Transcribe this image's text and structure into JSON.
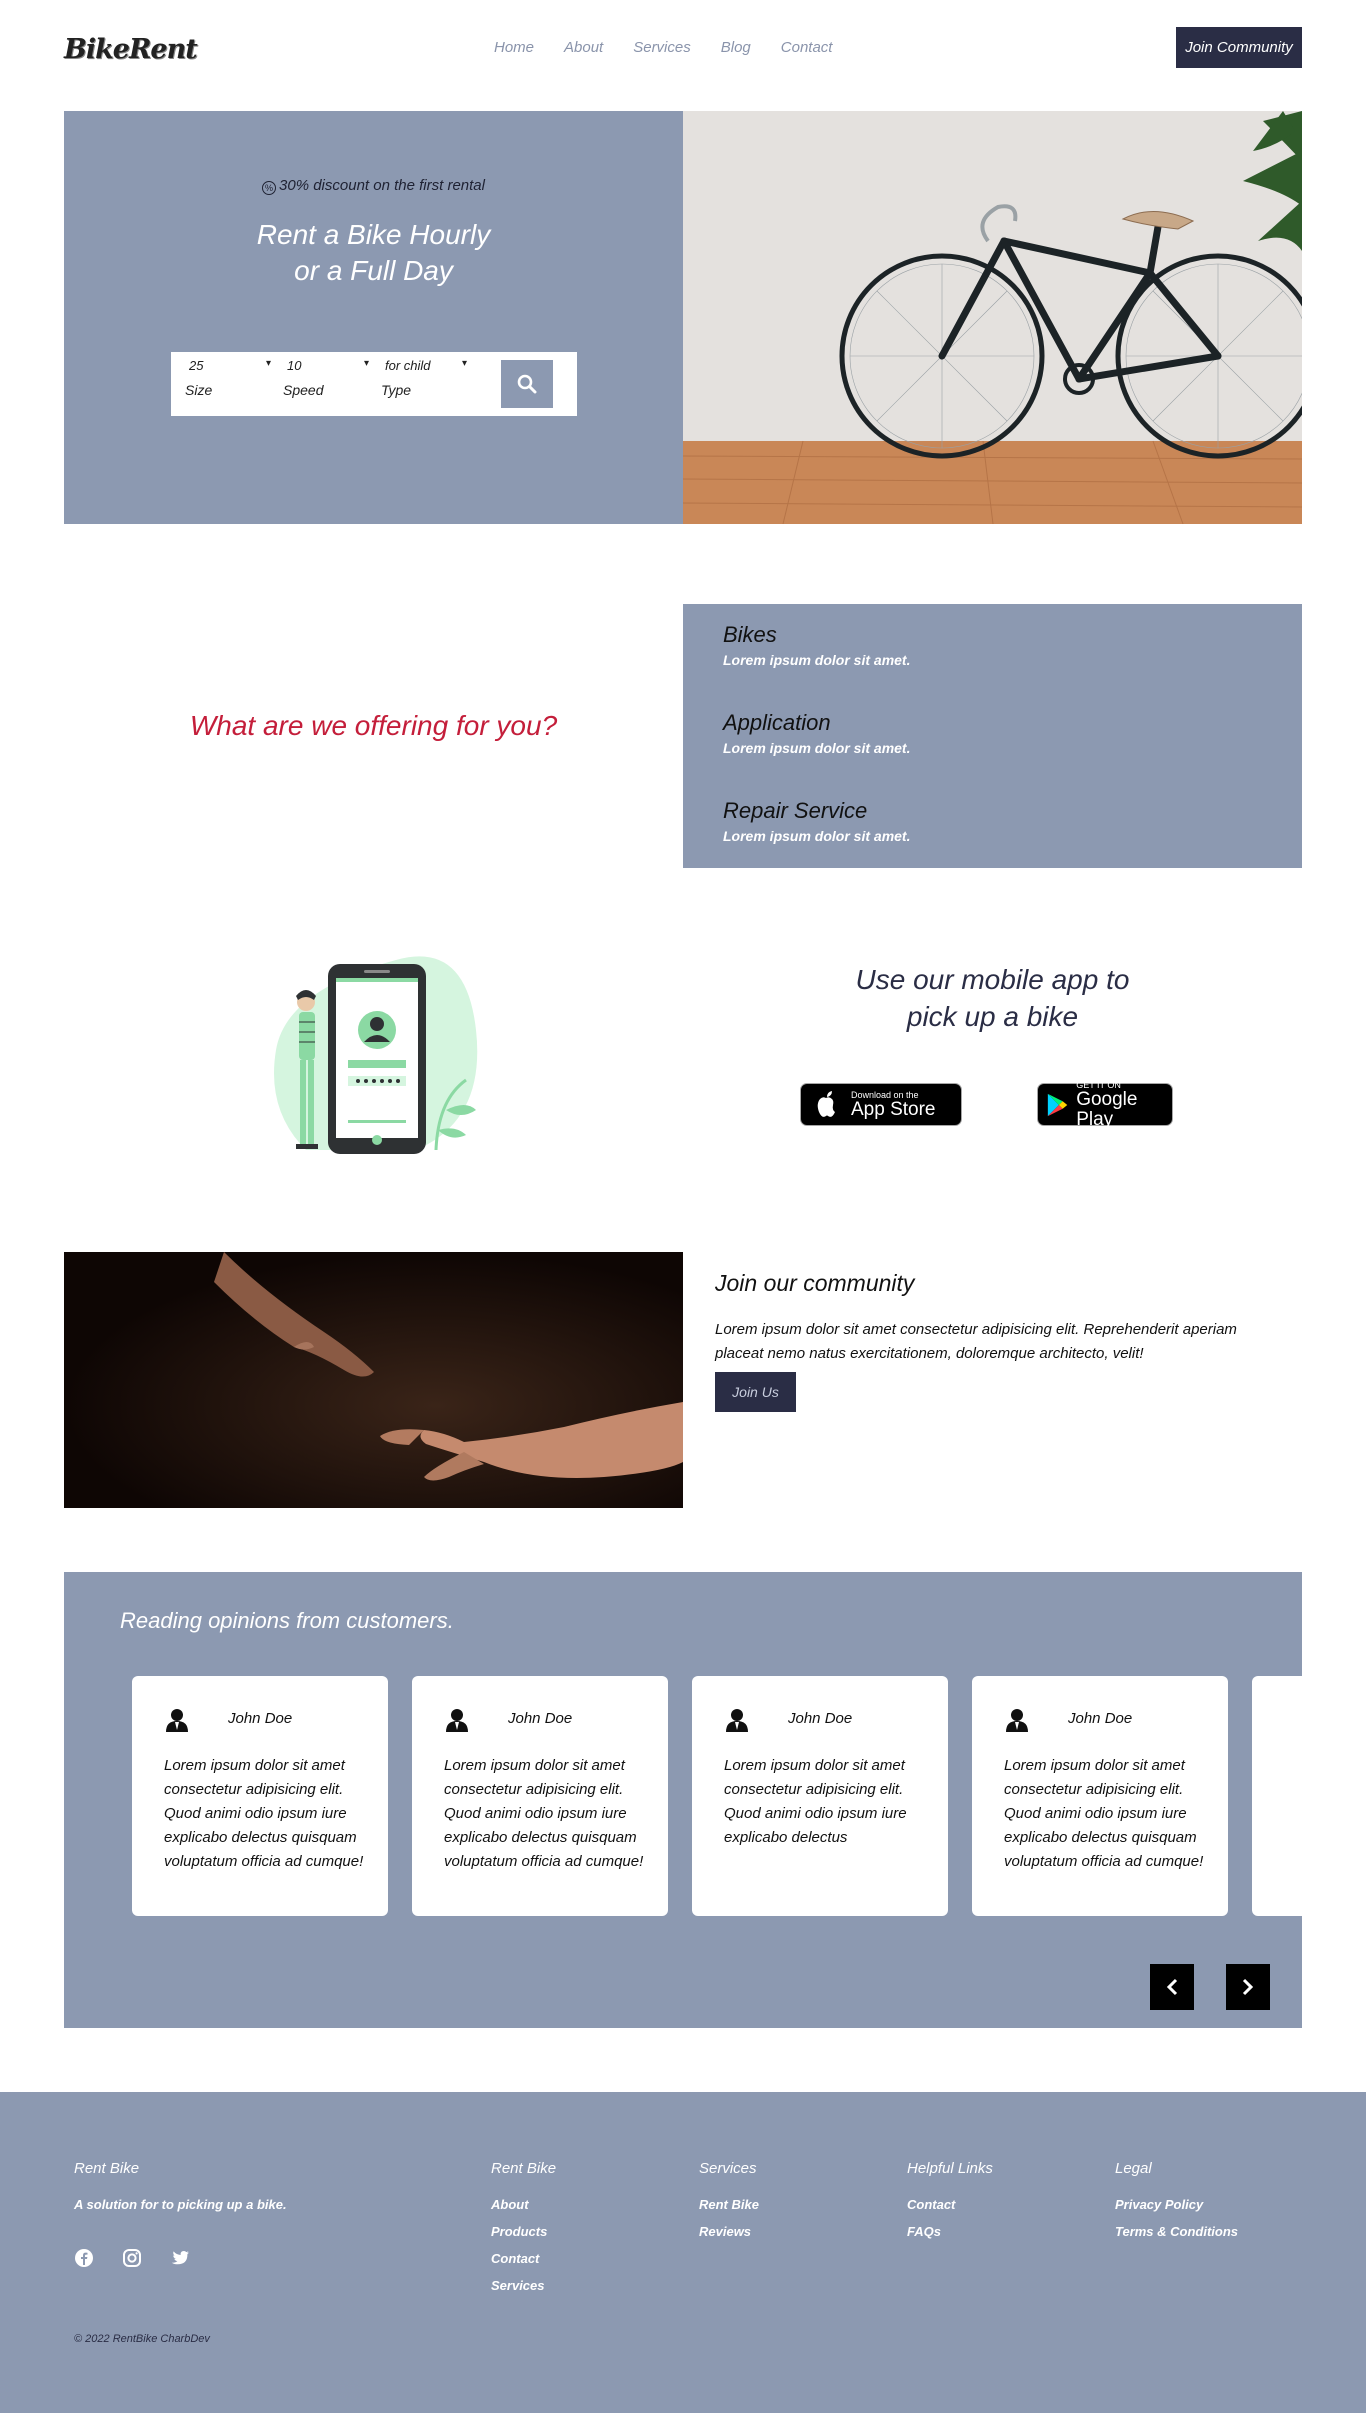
{
  "nav": {
    "logo": "BikeRent",
    "links": [
      "Home",
      "About",
      "Services",
      "Blog",
      "Contact"
    ],
    "join_label": "Join Community"
  },
  "hero": {
    "discount": "30% discount on the first rental",
    "title_line1": "Rent a Bike Hourly",
    "title_line2": "or a Full Day",
    "filters": [
      {
        "value": "25",
        "label": "Size"
      },
      {
        "value": "10",
        "label": "Speed"
      },
      {
        "value": "for child",
        "label": "Type"
      }
    ],
    "search_icon": "search-icon"
  },
  "offering": {
    "question": "What are we offering for you?",
    "items": [
      {
        "title": "Bikes",
        "desc": "Lorem ipsum dolor sit amet."
      },
      {
        "title": "Application",
        "desc": "Lorem ipsum dolor sit amet."
      },
      {
        "title": "Repair Service",
        "desc": "Lorem ipsum dolor sit amet."
      }
    ]
  },
  "app": {
    "title_line1": "Use our mobile app to",
    "title_line2": "pick up a bike",
    "appstore_small": "Download on the",
    "appstore_big": "App Store",
    "googleplay_small": "GET IT ON",
    "googleplay_big": "Google Play"
  },
  "community": {
    "title": "Join our community",
    "text": "Lorem ipsum dolor sit amet consectetur adipisicing elit. Reprehenderit aperiam placeat nemo natus exercitationem, doloremque architecto, velit!",
    "button": "Join Us"
  },
  "testimonials": {
    "title": "Reading opinions from customers.",
    "cards": [
      {
        "name": "John Doe",
        "text": "Lorem ipsum dolor sit amet consectetur adipisicing elit. Quod animi odio ipsum iure explicabo delectus quisquam voluptatum officia ad cumque!"
      },
      {
        "name": "John Doe",
        "text": "Lorem ipsum dolor sit amet consectetur adipisicing elit. Quod animi odio ipsum iure explicabo delectus quisquam voluptatum officia ad cumque!"
      },
      {
        "name": "John Doe",
        "text": "Lorem ipsum dolor sit amet consectetur adipisicing elit. Quod animi odio ipsum iure explicabo delectus"
      },
      {
        "name": "John Doe",
        "text": "Lorem ipsum dolor sit amet consectetur adipisicing elit. Quod animi odio ipsum iure explicabo delectus quisquam voluptatum officia ad cumque!"
      }
    ]
  },
  "footer": {
    "brand": "Rent Bike",
    "tagline": "A solution for to picking up a bike.",
    "columns": [
      {
        "heading": "Rent Bike",
        "links": [
          "About",
          "Products",
          "Contact",
          "Services"
        ]
      },
      {
        "heading": "Services",
        "links": [
          "Rent Bike",
          "Reviews"
        ]
      },
      {
        "heading": "Helpful Links",
        "links": [
          "Contact",
          "FAQs"
        ]
      },
      {
        "heading": "Legal",
        "links": [
          "Privacy Policy",
          "Terms & Conditions"
        ]
      }
    ],
    "social": [
      "facebook-icon",
      "instagram-icon",
      "twitter-icon"
    ],
    "copyright": "© 2022 RentBike CharbDev"
  }
}
